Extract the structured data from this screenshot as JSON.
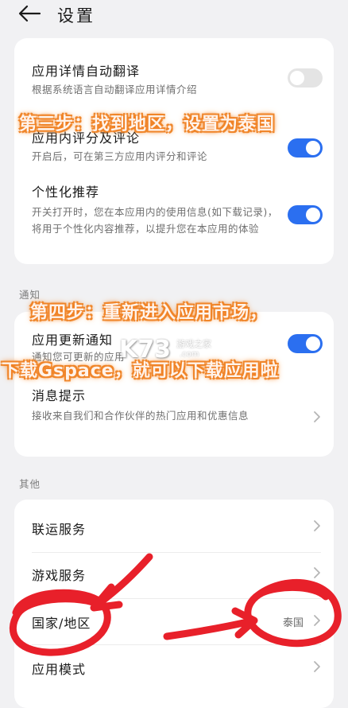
{
  "header": {
    "title": "设置"
  },
  "card1": {
    "item1": {
      "title": "应用详情自动翻译",
      "desc": "根据系统语言自动翻译应用详情介绍",
      "on": false
    },
    "item2": {
      "title": "应用内评分及评论",
      "desc": "开启后，可在第三方应用内评分和评论",
      "on": true
    },
    "item3": {
      "title": "个性化推荐",
      "desc": "开关打开时，您在本应用内的使用信息(如下载记录)，将用于个性化内容推荐，以提升您在本应用的体验",
      "on": true
    }
  },
  "sections": {
    "notify": "通知",
    "other": "其他"
  },
  "card2": {
    "item1": {
      "title": "应用更新通知",
      "desc": "通知您可更新的应用",
      "on": true
    },
    "item2": {
      "title": "消息提示",
      "desc": "接收来自我们和合作伙伴的热门应用和优惠信息"
    }
  },
  "card3": {
    "items": [
      {
        "title": "联运服务"
      },
      {
        "title": "游戏服务"
      },
      {
        "title": "国家/地区",
        "value": "泰国"
      },
      {
        "title": "应用模式"
      }
    ]
  },
  "annotations": {
    "step3": "第三步：找到地区，设置为泰国",
    "step4a": "第四步：重新进入应用市场，",
    "step4b": "下载Gspace，就可以下载应用啦"
  },
  "watermark": {
    "logo": "K73",
    "site": "游戏之家",
    "domain": ".com"
  },
  "colors": {
    "accent": "#2b6ff0",
    "annotation": "#f07a1c",
    "marker": "#e8202a"
  }
}
